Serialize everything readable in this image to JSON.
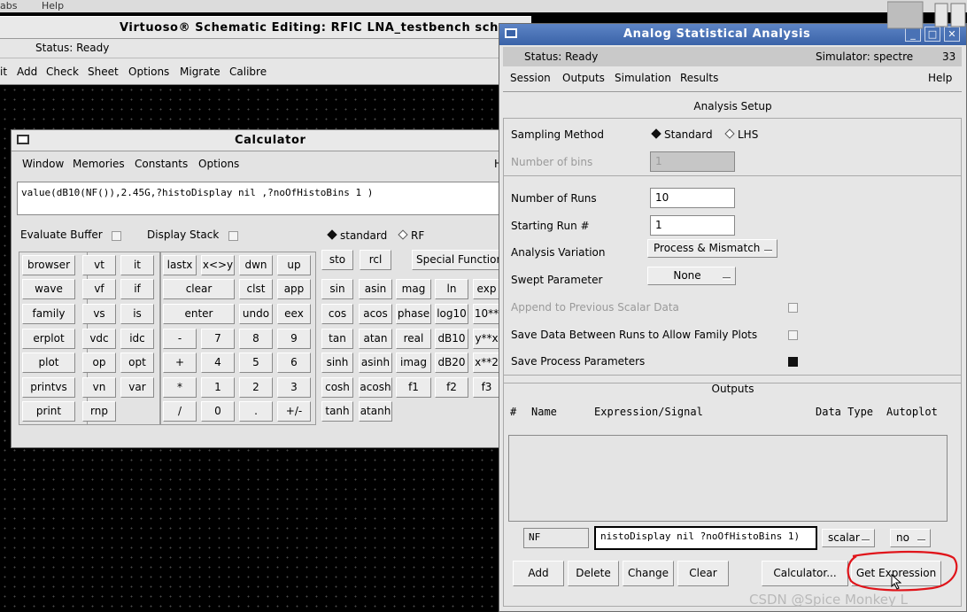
{
  "top_strip": {
    "items": [
      "abs",
      "Help"
    ]
  },
  "schematic": {
    "title": "Virtuoso® Schematic Editing: RFIC LNA_testbench scher",
    "status": "Status: Ready",
    "menu": [
      "it",
      "Add",
      "Check",
      "Sheet",
      "Options",
      "Migrate",
      "Calibre"
    ]
  },
  "calculator": {
    "title": "Calculator",
    "menu": [
      "Window",
      "Memories",
      "Constants",
      "Options"
    ],
    "menu_right": "H",
    "expression": "value(dB10(NF()),2.45G,?histoDisplay nil ,?noOfHistoBins 1 )",
    "evaluate_buffer": "Evaluate Buffer",
    "display_stack": "Display Stack",
    "mode_standard": "standard",
    "mode_rf": "RF",
    "functions": [
      [
        "browser",
        "wave",
        "family",
        "erplot",
        "plot",
        "printvs",
        "print"
      ],
      [
        "vt",
        "vf",
        "vs",
        "vdc",
        "op",
        "vn",
        "rnp"
      ],
      [
        "it",
        "if",
        "is",
        "idc",
        "opt",
        "var"
      ]
    ],
    "keypad_top": [
      "lastx",
      "x<>y",
      "dwn",
      "up"
    ],
    "keypad_clear": "clear",
    "keypad_clst": "clst",
    "keypad_app": "app",
    "keypad_enter": "enter",
    "keypad_undo": "undo",
    "keypad_eex": "eex",
    "keypad_rows": [
      [
        "-",
        "7",
        "8",
        "9"
      ],
      [
        "+",
        "4",
        "5",
        "6"
      ],
      [
        "*",
        "1",
        "2",
        "3"
      ],
      [
        "/",
        "0",
        ".",
        "+/-"
      ]
    ],
    "sto": "sto",
    "rcl": "rcl",
    "special_functions": "Special Function",
    "math": [
      [
        "sin",
        "asin",
        "mag",
        "ln",
        "exp"
      ],
      [
        "cos",
        "acos",
        "phase",
        "log10",
        "10**"
      ],
      [
        "tan",
        "atan",
        "real",
        "dB10",
        "y**x"
      ],
      [
        "sinh",
        "asinh",
        "imag",
        "dB20",
        "x**2"
      ],
      [
        "cosh",
        "acosh",
        "f1",
        "f2",
        "f3"
      ],
      [
        "tanh",
        "atanh"
      ]
    ]
  },
  "asa": {
    "title": "Analog Statistical Analysis",
    "status": "Status: Ready",
    "simulator": "Simulator: spectre",
    "status_num": "33",
    "menu": [
      "Session",
      "Outputs",
      "Simulation",
      "Results"
    ],
    "help": "Help",
    "setup_title": "Analysis Setup",
    "sampling_method": "Sampling Method",
    "standard": "Standard",
    "lhs": "LHS",
    "number_of_bins": "Number of bins",
    "bins_value": "1",
    "number_of_runs": "Number of Runs",
    "runs_value": "10",
    "starting_run": "Starting Run #",
    "starting_value": "1",
    "analysis_variation": "Analysis Variation",
    "variation_value": "Process & Mismatch",
    "swept_parameter": "Swept Parameter",
    "swept_value": "None",
    "append_label": "Append to Previous Scalar Data",
    "save_between": "Save Data Between Runs to Allow Family Plots",
    "save_process": "Save Process Parameters",
    "outputs_title": "Outputs",
    "columns": {
      "num": "#",
      "name": "Name",
      "expr": "Expression/Signal",
      "type": "Data Type",
      "autoplot": "Autoplot"
    },
    "name_field": "NF",
    "expr_field": "nistoDisplay nil ?noOfHistoBins 1)",
    "type_select": "scalar",
    "autoplot_select": "no",
    "buttons": {
      "add": "Add",
      "delete": "Delete",
      "change": "Change",
      "clear": "Clear",
      "calculator": "Calculator...",
      "get_expression": "Get Expression"
    }
  },
  "watermark": "CSDN @Spice Monkey L",
  "colors": {
    "title_blue": "#4a72b5",
    "annotation_red": "#e0141a"
  }
}
